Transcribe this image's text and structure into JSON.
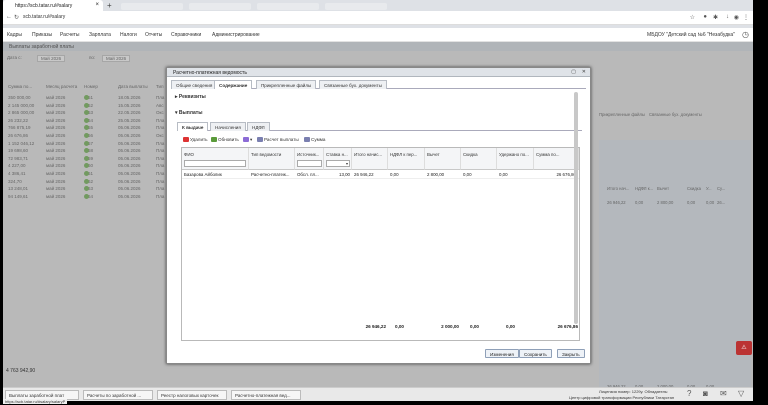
{
  "browser": {
    "tab_title": "https://scb.tatar.ru/#salary",
    "url": "scb.tatar.ru/#salary",
    "new_tab": "+",
    "close": "×"
  },
  "menu": {
    "items": [
      "Кадры",
      "Приказы",
      "Расчеты",
      "Зарплата",
      "Налоги",
      "Отчеты",
      "Справочники",
      "Администрирование"
    ],
    "org": "МБДОУ \"Детский сад №6 \"Незабудка\""
  },
  "bg": {
    "title": "Выплаты заработной платы",
    "date_from_label": "Дата с:",
    "date_from": "Май 2026",
    "date_to_label": "по:",
    "date_to": "Май 2026",
    "cols": [
      "Сумма по...",
      "Месяц расчета",
      "Номер",
      "Дата выплаты",
      "Тип"
    ],
    "rows": [
      [
        "350 000,00",
        "май 2026",
        "51",
        "18.05.2026",
        "Пла"
      ],
      [
        "2 145 000,00",
        "май 2026",
        "52",
        "15.05.2026",
        "Авс"
      ],
      [
        "2 865 000,00",
        "май 2026",
        "53",
        "22.05.2026",
        "Окс"
      ],
      [
        "26 232,22",
        "май 2026",
        "54",
        "25.05.2026",
        "Пла"
      ],
      [
        "766 875,19",
        "май 2026",
        "55",
        "05.06.2026",
        "Пла"
      ],
      [
        "26 676,86",
        "май 2026",
        "56",
        "05.06.2026",
        "Окс"
      ],
      [
        "1 152 046,12",
        "май 2026",
        "57",
        "05.06.2026",
        "Пла"
      ],
      [
        "19 698,60",
        "май 2026",
        "58",
        "05.06.2026",
        "Пла"
      ],
      [
        "72 983,71",
        "май 2026",
        "59",
        "05.06.2026",
        "Пла"
      ],
      [
        "4 227,00",
        "май 2026",
        "60",
        "05.06.2026",
        "Пла"
      ],
      [
        "4 386,41",
        "май 2026",
        "61",
        "05.06.2026",
        "Пла"
      ],
      [
        "324,70",
        "май 2026",
        "62",
        "05.06.2026",
        "Пла"
      ],
      [
        "13 248,01",
        "май 2026",
        "63",
        "05.06.2026",
        "Пла"
      ],
      [
        "94 149,61",
        "май 2026",
        "64",
        "05.06.2026",
        "Пла"
      ]
    ],
    "total": "4 763 942,90",
    "right_tabs": [
      "Прикрепленные файлы",
      "Связанные бух. документы"
    ],
    "right_cols": [
      "Итого нач...",
      "НДФЛ к...",
      "Вычет",
      "Скидка",
      "У...",
      "Су..."
    ],
    "right_row": [
      "26 946,22",
      "0,00",
      "2 800,00",
      "0,00",
      "0,00",
      "26..."
    ],
    "right_footer": [
      "26 946,22",
      "0,00",
      "2 000,00",
      "0,00",
      "0,00"
    ]
  },
  "dialog": {
    "title": "Расчетно-платежная ведомость",
    "tabs": [
      "Общие сведения",
      "Содержание",
      "Прикрепленные файлы",
      "Связанные бух. документы"
    ],
    "active_tab": "Содержание",
    "sec1": "Реквизиты",
    "sec2": "Выплаты",
    "subtabs": [
      "К выдаче",
      "Начисления",
      "НДФЛ"
    ],
    "toolbar": [
      "Удалить",
      "Обновить",
      "Расчет выплаты",
      "Сумма"
    ],
    "cols": [
      "ФИО",
      "Тип ведомости",
      "Источник...",
      "Ставка н...",
      "Итого начис...",
      "НДФЛ к пер...",
      "Вычет",
      "Скидка",
      "Удержано по...",
      "Сумма по..."
    ],
    "row": [
      "Базарова Айболик",
      "Расчетно-платеж...",
      "Обсл. пл...",
      "13,00",
      "26 946,22",
      "0,00",
      "2 800,00",
      "0,00",
      "0,00",
      "26 676,86"
    ],
    "footer": [
      "26 946,22",
      "0,00",
      "2 000,00",
      "0,00",
      "0,00",
      "26 676,86"
    ],
    "buttons": [
      "Изменения",
      "Сохранить",
      "Закрыть"
    ]
  },
  "taskbar": {
    "items": [
      "Выплаты заработной плат",
      "Расчеты по заработной ...",
      "Реестр налоговых карточек",
      "Расчетно-платежная вед..."
    ],
    "license": "Лицензия номер: 1229у. Обладатель:",
    "center": "Центр цифровой трансформации Республики Татарстан",
    "status_url": "https://scb.tatar.ru/#salary/salaryP"
  }
}
